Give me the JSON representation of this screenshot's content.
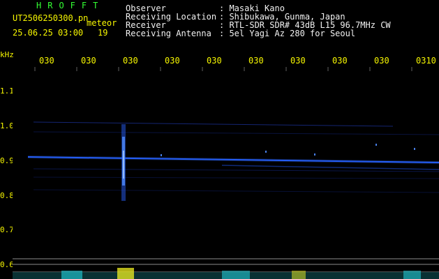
{
  "header": {
    "station_title": "HROFFT",
    "file_name": "UT2506250300.pn",
    "meteor_label": "meteor",
    "date_time": "25.06.25 03:00",
    "meteor_count": "19"
  },
  "info": [
    {
      "label": "Observer",
      "value": ": Masaki Kano"
    },
    {
      "label": "Receiving Location",
      "value": ": Shibukawa, Gunma, Japan"
    },
    {
      "label": "Receiver",
      "value": ": RTL-SDR SDR# 43dB L15 96.7MHz CW"
    },
    {
      "label": "Receiving Antenna",
      "value": ": 5el Yagi Az 280 for Seoul"
    }
  ],
  "axis": {
    "y_unit": "kHz",
    "x_ticks": [
      "030",
      "030",
      "030",
      "030",
      "030",
      "030",
      "030",
      "030",
      "030",
      "0310"
    ],
    "y_ticks": [
      "1.1",
      "1.0",
      "0.9",
      "0.8",
      "0.7",
      "0.6"
    ]
  },
  "colors": {
    "background": "#000000",
    "text_white": "#f2f2f2",
    "text_yellow": "#f7f700",
    "title_green": "#33ff33",
    "signal_blue": "#1f5cff",
    "meteor_blue": "#4f8cff",
    "activity_cyan": "#22d3e0",
    "activity_yellow": "#f0f020"
  }
}
